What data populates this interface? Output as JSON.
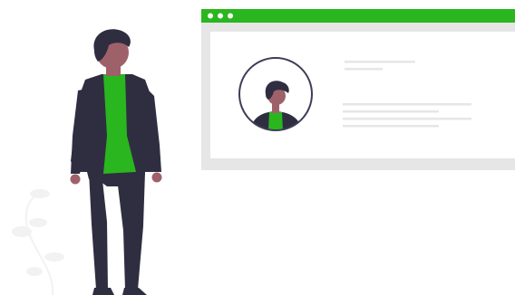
{
  "illustration": {
    "subject": "person-standing-beside-profile-window",
    "browser": {
      "accent": "#2ab61f",
      "dots": 3
    },
    "profile_card": {
      "avatar": "user-avatar",
      "text_lines": 6
    },
    "colors": {
      "suit": "#2f2e41",
      "shirt": "#2ab61f",
      "skin": "#9e616a",
      "hair": "#2f2e41",
      "window_frame": "#e6e6e6",
      "plant": "#f2f2f2",
      "text_line": "#e6e6e6"
    }
  }
}
